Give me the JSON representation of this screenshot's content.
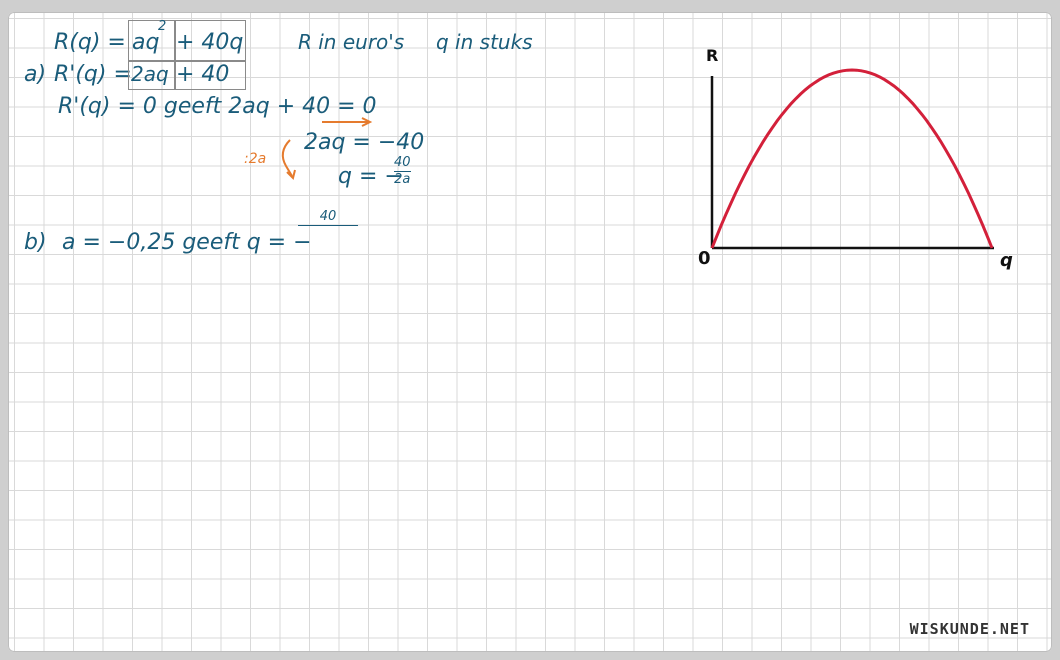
{
  "definition": {
    "lhs": "R(q) =",
    "term1": "aq",
    "term1_exponent": "2",
    "term2": "+ 40q",
    "unit_r": "R in euro's",
    "unit_q": "q in stuks"
  },
  "part_a": {
    "label": "a)",
    "derivative_lhs": "R'(q) =",
    "derivative_term1": "2aq",
    "derivative_term2": "+ 40",
    "step1": "R'(q) = 0   geeft   2aq + 40 = 0",
    "step2": "2aq = −40",
    "divide_note": ":2a",
    "step3_lhs": "q = −",
    "step3_num": "40",
    "step3_den": "2a"
  },
  "part_b": {
    "label": "b)",
    "text": "a = −0,25   geeft   q = −",
    "frac_num": "40"
  },
  "graph": {
    "y_label": "R",
    "x_label": "q",
    "origin_label": "0",
    "curve_color": "#d3203a",
    "axis_color": "#111111"
  },
  "brand": "WISKUNDE.NET"
}
